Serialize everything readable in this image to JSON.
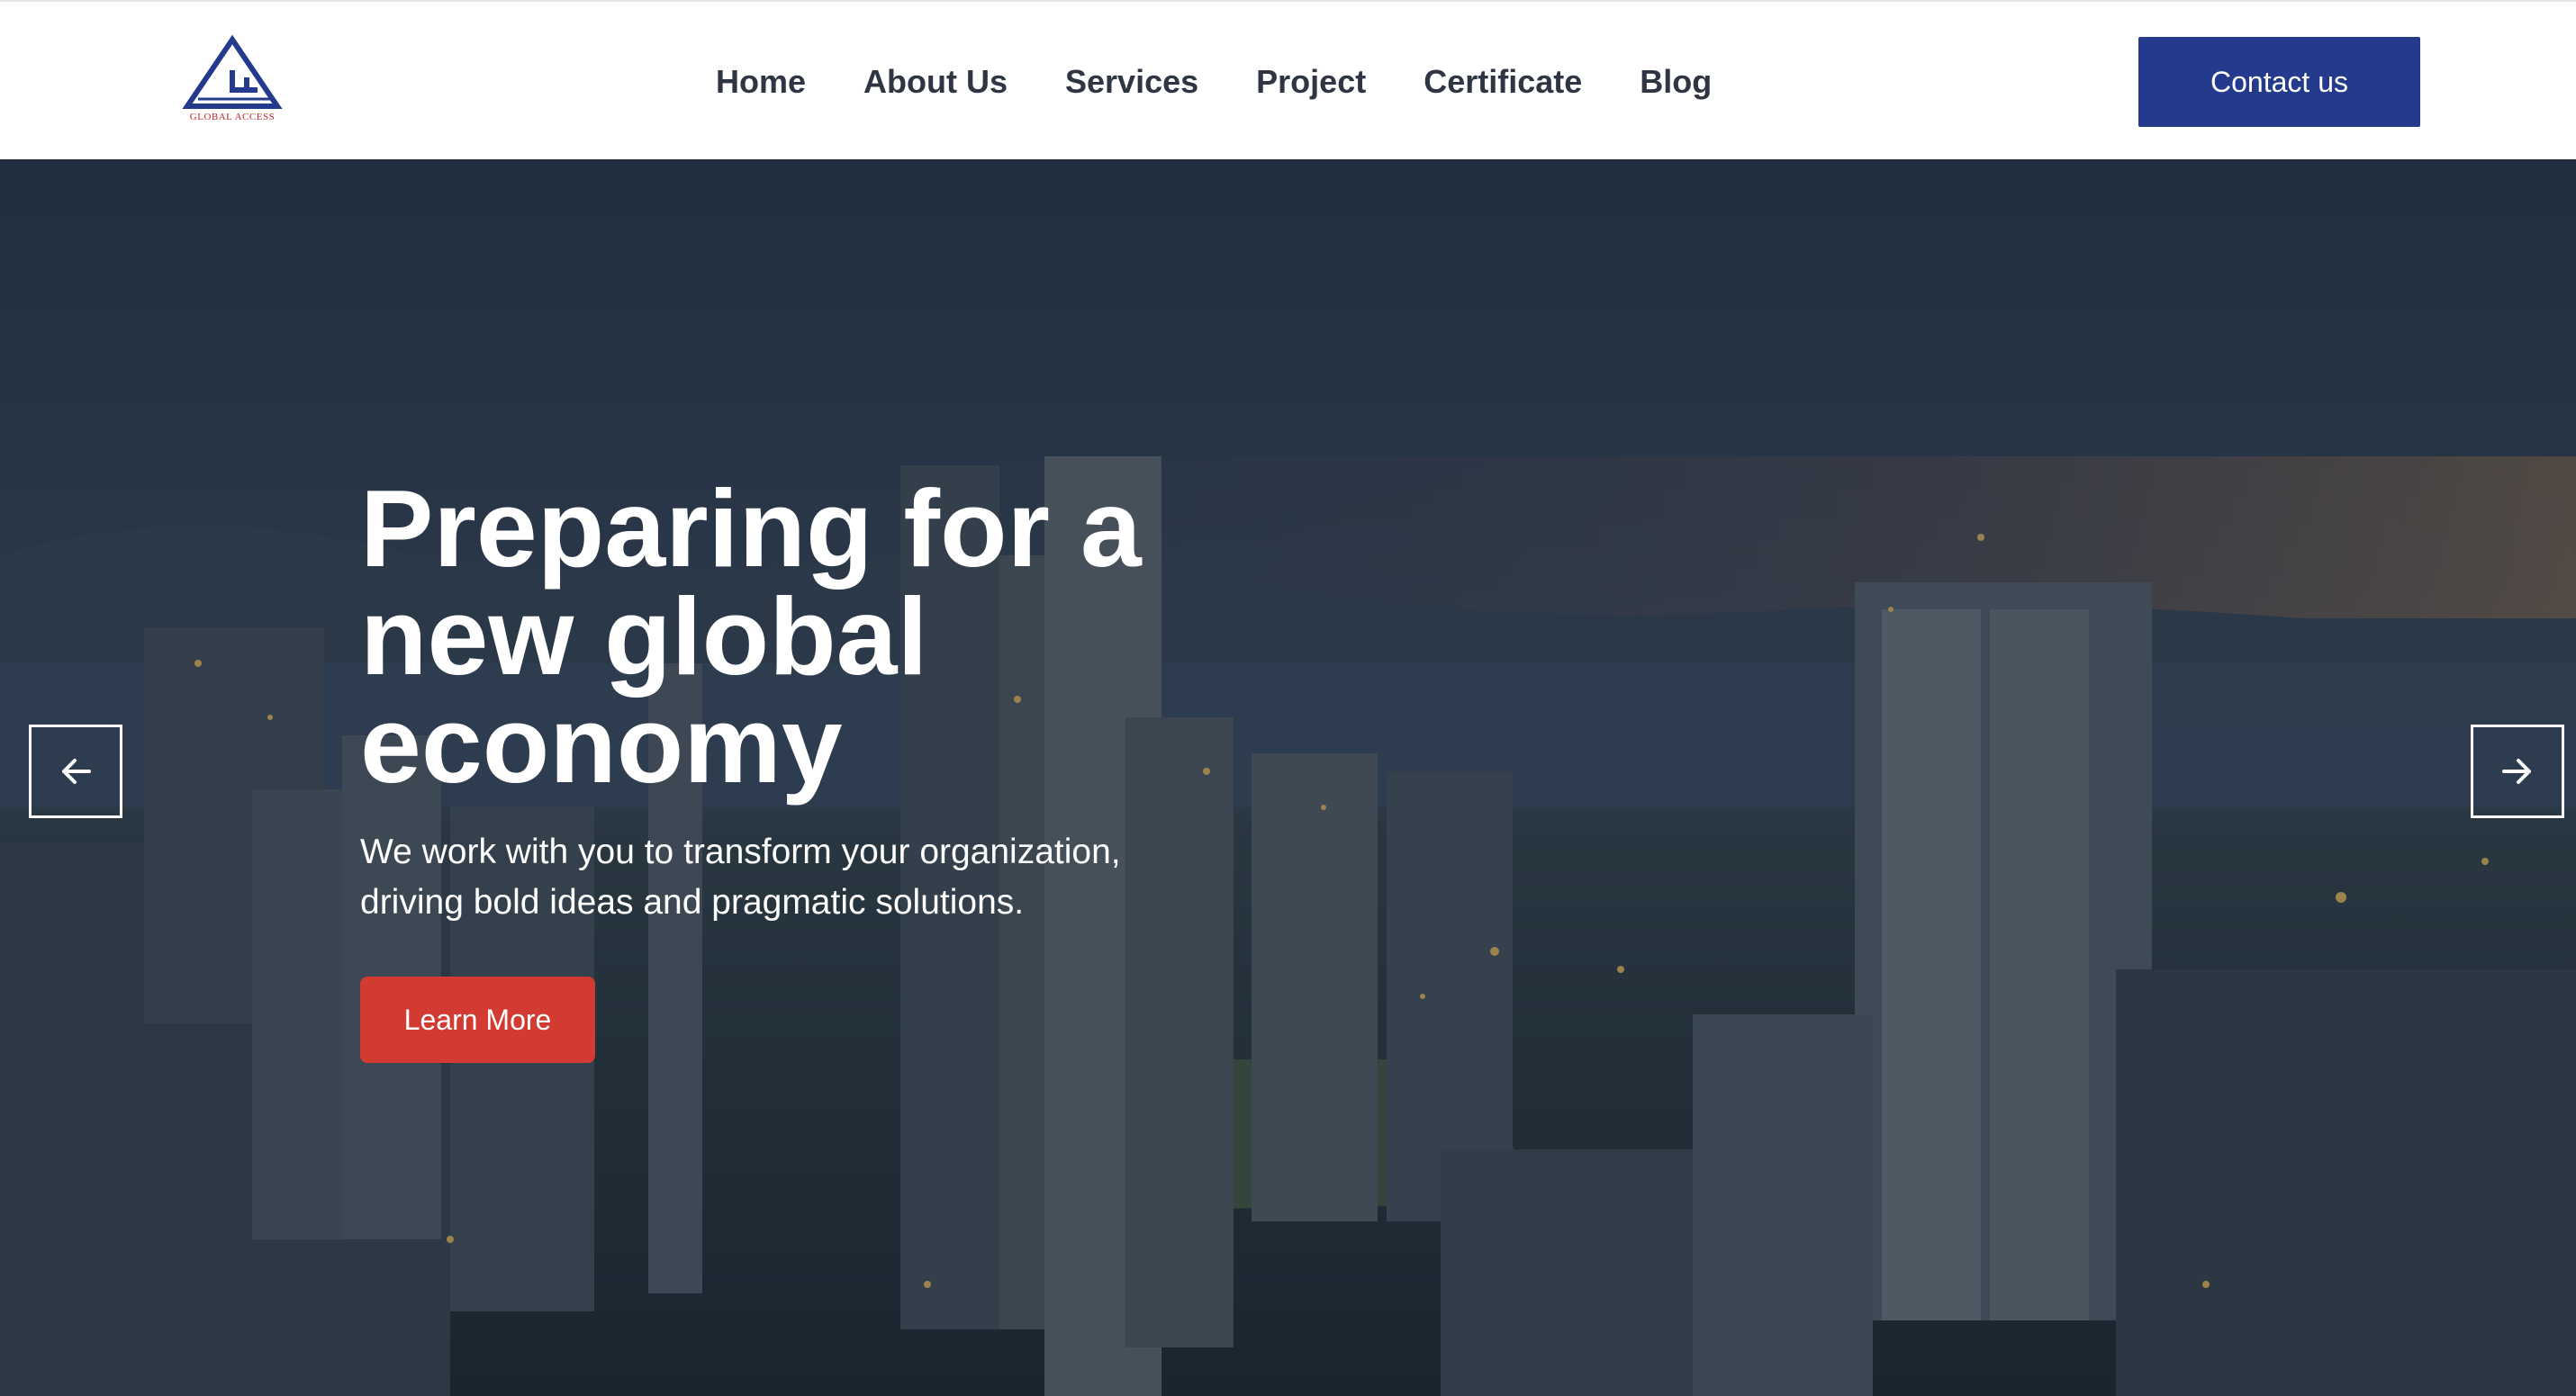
{
  "brand": {
    "logo_text": "GLOBAL ACCESS",
    "accent": "#243a8c",
    "logo_red": "#c0282d"
  },
  "nav": {
    "items": [
      {
        "label": "Home"
      },
      {
        "label": "About Us"
      },
      {
        "label": "Services"
      },
      {
        "label": "Project"
      },
      {
        "label": "Certificate"
      },
      {
        "label": "Blog"
      }
    ],
    "contact_label": "Contact us"
  },
  "hero": {
    "title": "Preparing for a new global economy",
    "subtitle": "We work with you to transform your organization, driving bold ideas and pragmatic solutions.",
    "cta_label": "Learn More",
    "cta_color": "#d23a32",
    "prev_icon": "arrow-left-icon",
    "next_icon": "arrow-right-icon"
  }
}
